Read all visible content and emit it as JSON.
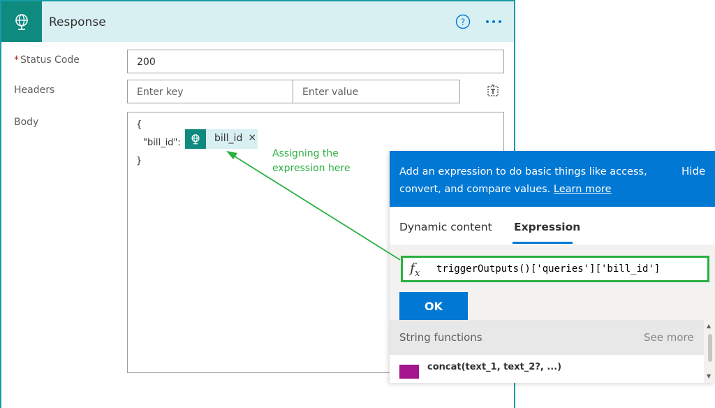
{
  "card": {
    "title": "Response",
    "status_code": {
      "required_mark": "*",
      "label": "Status Code",
      "value": "200"
    },
    "headers": {
      "label": "Headers",
      "key_placeholder": "Enter key",
      "value_placeholder": "Enter value"
    },
    "body": {
      "label": "Body",
      "open_brace": "{",
      "key_text": "\"bill_id\":",
      "close_brace": "}",
      "token_label": "bill_id",
      "token_close": "×"
    }
  },
  "annotation": {
    "line1": "Assigning the",
    "line2": "expression here"
  },
  "panel": {
    "banner_text": "Add an expression to do basic things like access, convert, and compare values.",
    "learn_more": "Learn more",
    "hide_label": "Hide",
    "tabs": [
      {
        "label": "Dynamic content",
        "active": false
      },
      {
        "label": "Expression",
        "active": true
      }
    ],
    "expression": "triggerOutputs()['queries']['bill_id']",
    "ok_label": "OK",
    "functions": {
      "section_title": "String functions",
      "see_more": "See more",
      "first_item": "concat(text_1, text_2?, ...)"
    }
  },
  "colors": {
    "accent_teal": "#0e8a7f",
    "card_border": "#179ba6",
    "panel_blue": "#0078d4",
    "annotation_green": "#2ab040"
  },
  "icons": {
    "card_icon": "globe-request-icon",
    "help": "help-circle-icon",
    "more": "ellipsis-icon",
    "delete": "delete-table-icon",
    "fx": "function-icon"
  }
}
